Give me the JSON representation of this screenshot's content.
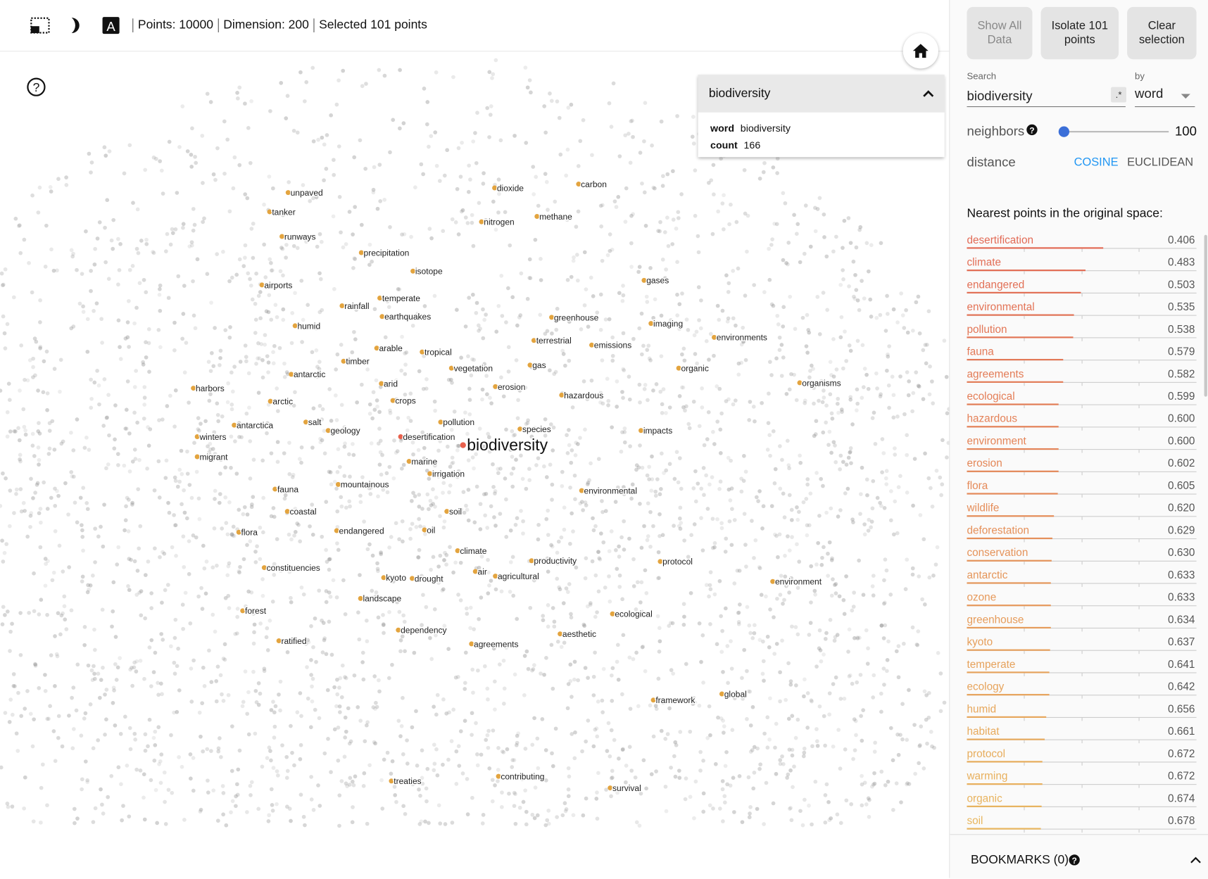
{
  "toolbar": {
    "points": "Points: 10000",
    "dimension": "Dimension: 200",
    "selected": "Selected 101 points",
    "icons": [
      "selection-icon",
      "night-mode-icon",
      "labels-icon"
    ]
  },
  "card": {
    "title": "biodiversity",
    "word_label": "word",
    "word_value": "biodiversity",
    "count_label": "count",
    "count_value": "166"
  },
  "plot": {
    "selected_word": "biodiversity",
    "labels": [
      "unpaved",
      "dioxide",
      "carbon",
      "tanker",
      "nitrogen",
      "methane",
      "runways",
      "precipitation",
      "isotope",
      "airports",
      "gases",
      "temperate",
      "rainfall",
      "earthquakes",
      "greenhouse",
      "imaging",
      "humid",
      "environments",
      "terrestrial",
      "emissions",
      "arable",
      "tropical",
      "timber",
      "gas",
      "vegetation",
      "organic",
      "antarctic",
      "arid",
      "erosion",
      "organisms",
      "harbors",
      "hazardous",
      "arctic",
      "crops",
      "pollution",
      "antarctica",
      "salt",
      "geology",
      "species",
      "impacts",
      "winters",
      "desertification",
      "migrant",
      "marine",
      "irrigation",
      "fauna",
      "mountainous",
      "environmental",
      "coastal",
      "soil",
      "flora",
      "endangered",
      "oil",
      "climate",
      "productivity",
      "protocol",
      "constituencies",
      "air",
      "agricultural",
      "kyoto",
      "drought",
      "environment",
      "landscape",
      "forest",
      "ecological",
      "dependency",
      "aesthetic",
      "ratified",
      "agreements",
      "framework",
      "global",
      "treaties",
      "contributing",
      "survival"
    ],
    "colors": {
      "selected": "#e8604c",
      "neighbor": "#e3a43f",
      "background": "#8a8a8a"
    }
  },
  "sidebar": {
    "show_all": "Show All Data",
    "isolate": "Isolate 101 points",
    "clear": "Clear selection",
    "search_label": "Search",
    "search_value": "biodiversity",
    "regex": ".*",
    "by_label": "by",
    "by_value": "word",
    "neighbors_label": "neighbors",
    "neighbors_value": "100",
    "neighbors_fraction": 0.03,
    "distance_label": "distance",
    "cosine": "COSINE",
    "euclidean": "EUCLIDEAN",
    "active_distance": "COSINE",
    "accent": "#2196f3",
    "nn_title": "Nearest points in the original space:",
    "nearest": [
      {
        "word": "desertification",
        "d": "0.406"
      },
      {
        "word": "climate",
        "d": "0.483"
      },
      {
        "word": "endangered",
        "d": "0.503"
      },
      {
        "word": "environmental",
        "d": "0.535"
      },
      {
        "word": "pollution",
        "d": "0.538"
      },
      {
        "word": "fauna",
        "d": "0.579"
      },
      {
        "word": "agreements",
        "d": "0.582"
      },
      {
        "word": "ecological",
        "d": "0.599"
      },
      {
        "word": "hazardous",
        "d": "0.600"
      },
      {
        "word": "environment",
        "d": "0.600"
      },
      {
        "word": "erosion",
        "d": "0.602"
      },
      {
        "word": "flora",
        "d": "0.605"
      },
      {
        "word": "wildlife",
        "d": "0.620"
      },
      {
        "word": "deforestation",
        "d": "0.629"
      },
      {
        "word": "conservation",
        "d": "0.630"
      },
      {
        "word": "antarctic",
        "d": "0.633"
      },
      {
        "word": "ozone",
        "d": "0.633"
      },
      {
        "word": "greenhouse",
        "d": "0.634"
      },
      {
        "word": "kyoto",
        "d": "0.637"
      },
      {
        "word": "temperate",
        "d": "0.641"
      },
      {
        "word": "ecology",
        "d": "0.642"
      },
      {
        "word": "humid",
        "d": "0.656"
      },
      {
        "word": "habitat",
        "d": "0.661"
      },
      {
        "word": "protocol",
        "d": "0.672"
      },
      {
        "word": "warming",
        "d": "0.672"
      },
      {
        "word": "organic",
        "d": "0.674"
      },
      {
        "word": "soil",
        "d": "0.678"
      }
    ],
    "nn_color_start": "#e26a55",
    "nn_color_end": "#e8b65e",
    "bookmarks": "BOOKMARKS (0)"
  }
}
